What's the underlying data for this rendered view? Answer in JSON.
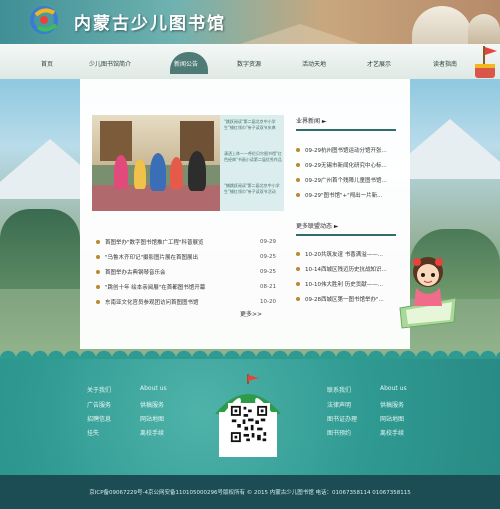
{
  "header": {
    "site_title": "内蒙古少儿图书馆"
  },
  "nav": {
    "items": [
      {
        "label": "首页"
      },
      {
        "label": "少儿图书馆简介"
      },
      {
        "label": "新闻公告"
      },
      {
        "label": "数字资源"
      },
      {
        "label": "活动天地"
      },
      {
        "label": "才艺展示"
      },
      {
        "label": "读者指南"
      }
    ],
    "active_index": 2
  },
  "feature": {
    "captions": [
      "\"跳跃阅读\"第二届北京中小学生\"捕红领巾\"亲子读双节庆典",
      "潇洒上阵——呼伦贝尔图书馆\"红色经典\"书画小读第二届优秀作品",
      "\"捕跳跃阅读\"第二届北京中小学生\"捕红领巾\"亲子读双节活动"
    ]
  },
  "news": {
    "items": [
      {
        "title": "首图举办\"数字图书馆推广工程\"科普展览",
        "date": "09-29"
      },
      {
        "title": "\"乌鲁木齐印记\"摄影图片展在首图展出",
        "date": "09-25"
      },
      {
        "title": "首图举办古典钢琴音乐会",
        "date": "09-25"
      },
      {
        "title": "\"跳创十年 绘本亲阅展\"在首都图书馆开幕",
        "date": "08-21"
      },
      {
        "title": "东南亚文化官员参观团访问首图图书馆",
        "date": "10-20"
      }
    ],
    "more_label": "更多>>"
  },
  "industry_news": {
    "title": "业界新闻 ►",
    "items": [
      {
        "title": "09-29杭州图书馆运动分馆开张..."
      },
      {
        "title": "09-29无锡市新闻化研究中心标..."
      },
      {
        "title": "09-29广州首个残障儿童图书馆..."
      },
      {
        "title": "09-29\"图书馆\"+\"闯出一片新..."
      }
    ]
  },
  "more_reports": {
    "title": "更多联盟动态 ►",
    "items": [
      {
        "title": "10-20共筑友谊 书香满溢——..."
      },
      {
        "title": "10-14西城区残迈历史抗战知识..."
      },
      {
        "title": "10-10伟大胜利 历史贡献——..."
      },
      {
        "title": "09-28西城区第一图书馆举办\"..."
      }
    ]
  },
  "footer": {
    "left_col1": [
      "关于我们",
      "广告服务",
      "招聘信息",
      "挂失"
    ],
    "left_col2": [
      "About us",
      "供稿服务",
      "网站地图",
      "离校手续"
    ],
    "right_col1": [
      "联系我们",
      "法律声明",
      "图书证办理",
      "图书预约"
    ],
    "right_col2": [
      "About us",
      "供稿服务",
      "网站地图",
      "离校手续"
    ],
    "copyright": "京ICP备09067229号-4京公网安备110105000296号版权所有 © 2015 内蒙古少儿图书馆     电话：01067358114 01067358115"
  },
  "colors": {
    "accent": "#2f6e6a",
    "footer": "#2f9a92",
    "bottom_bar": "#1c4d55",
    "bullet": "#b98a2e"
  }
}
